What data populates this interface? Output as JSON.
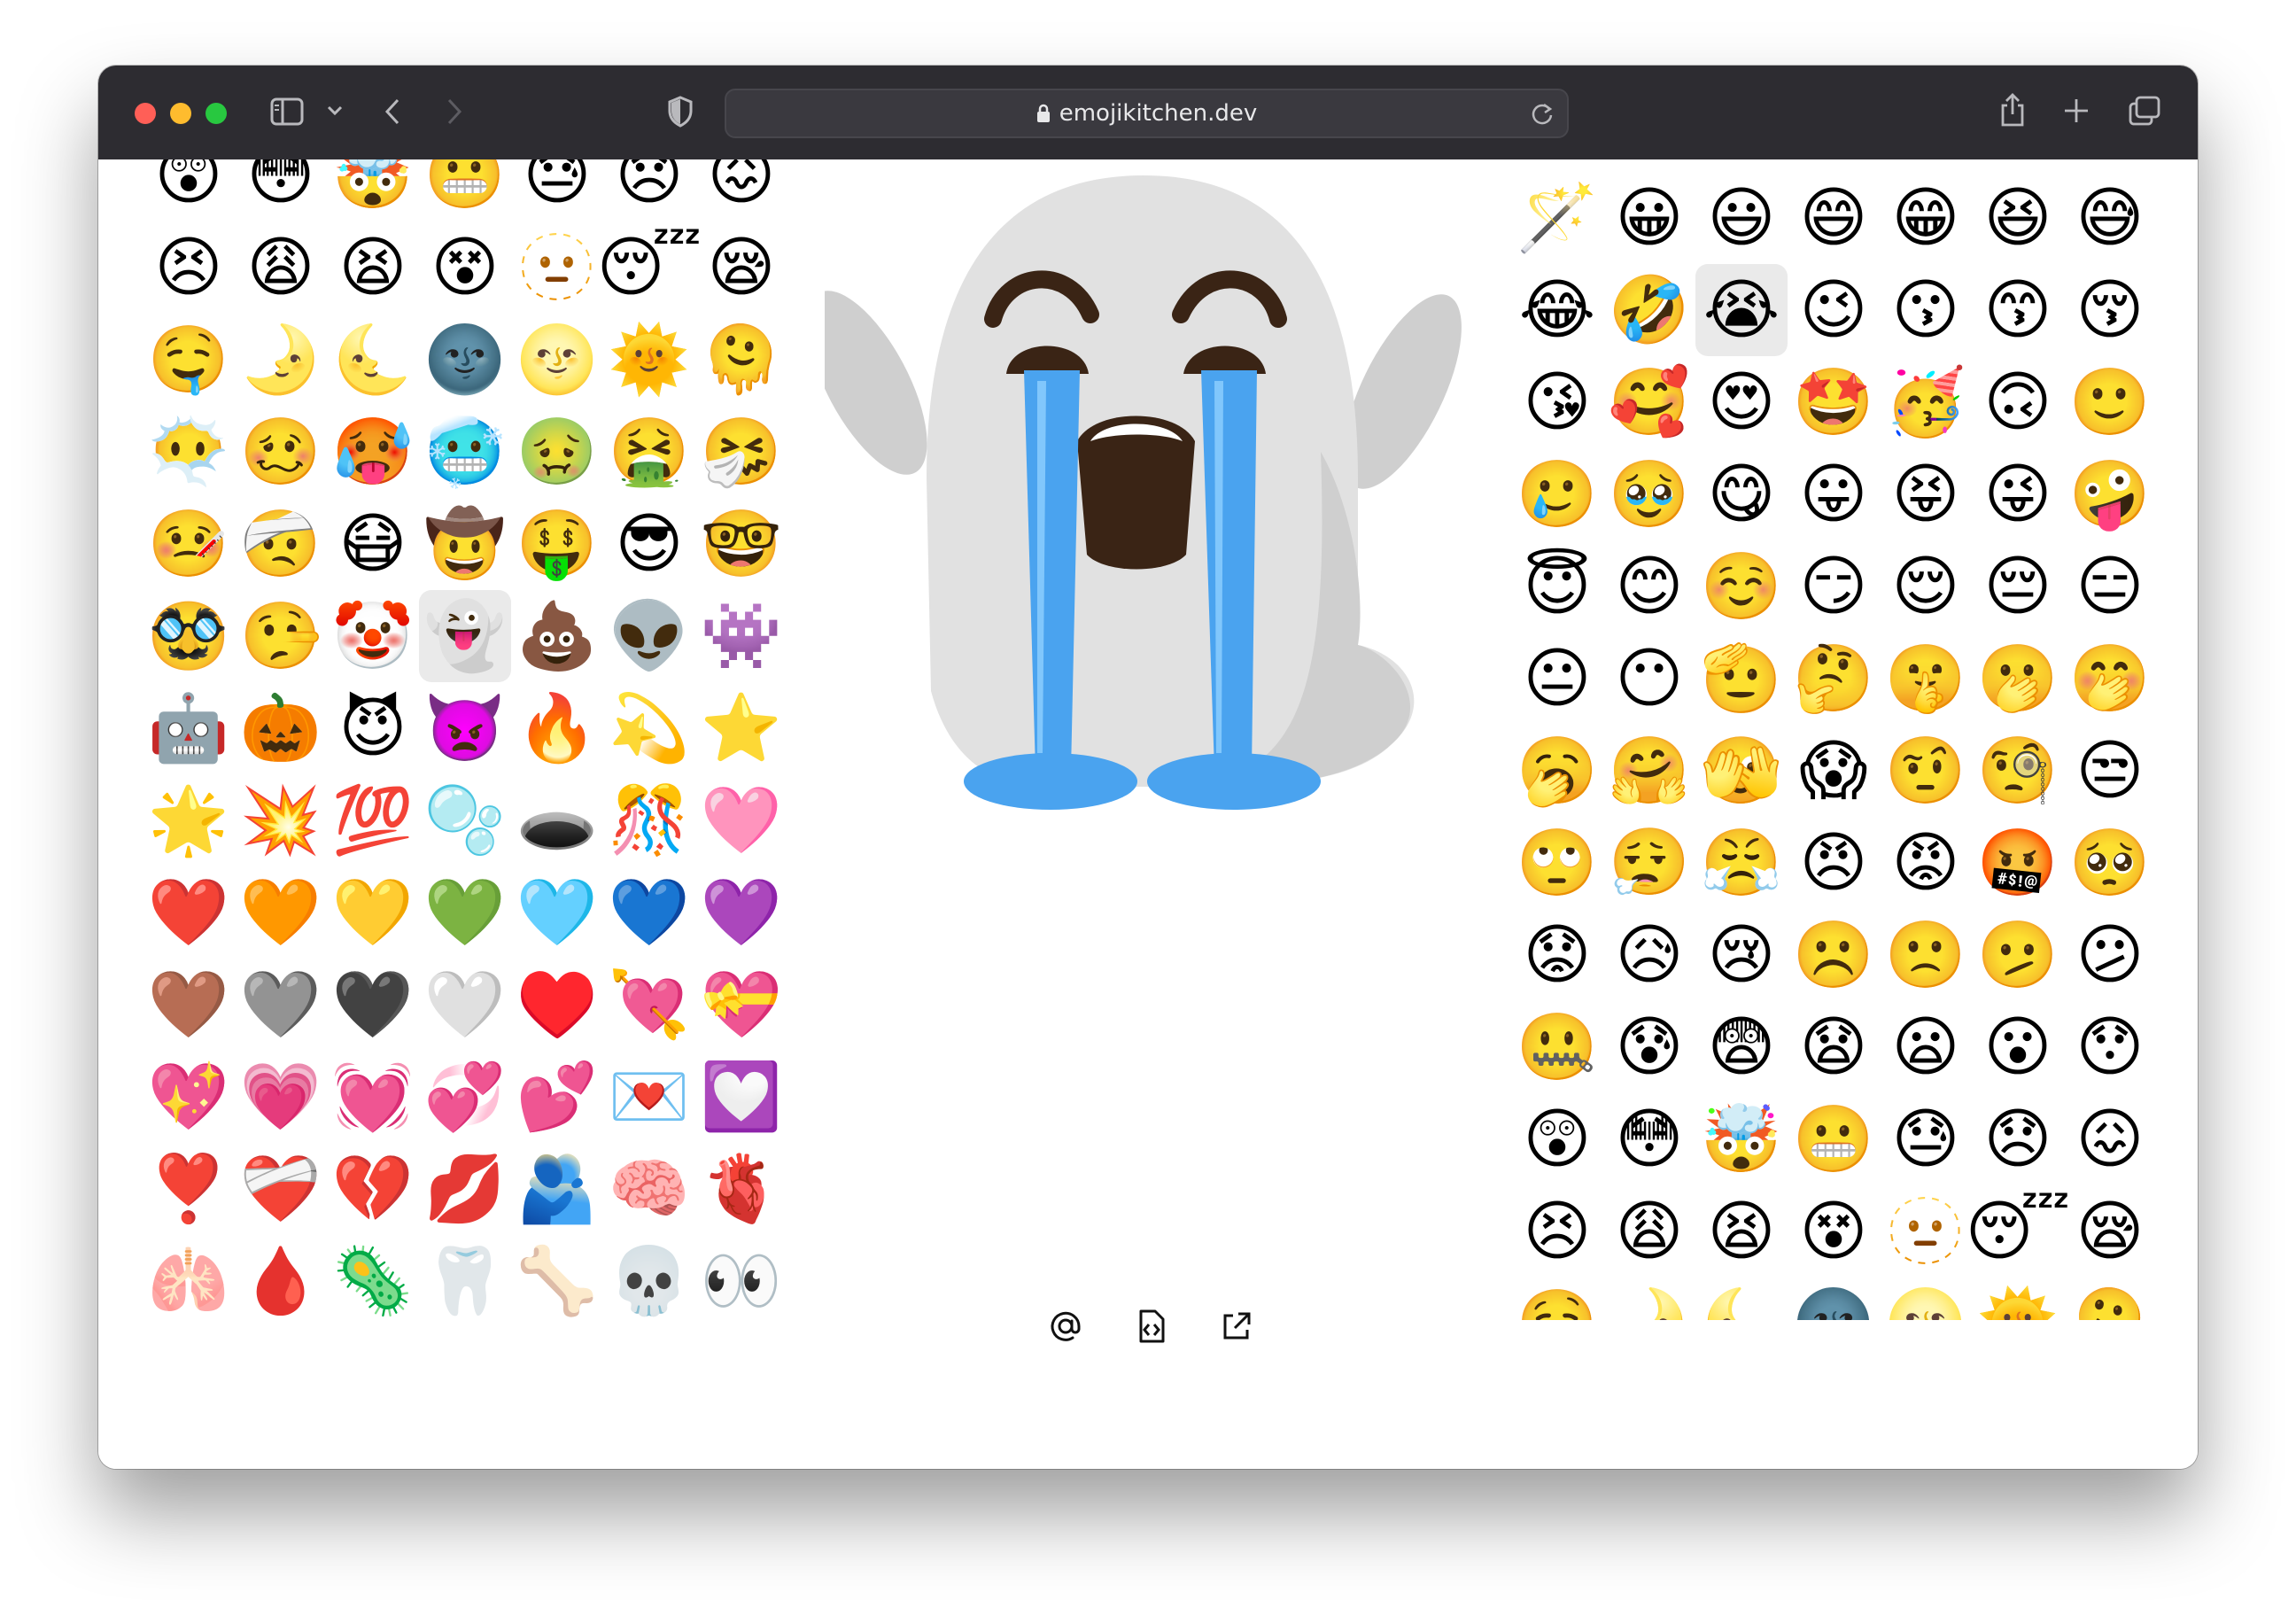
{
  "browser": {
    "url": "emojikitchen.dev",
    "icons": [
      "sidebar-icon",
      "chevron-down-icon",
      "back-icon",
      "forward-icon",
      "shield-icon",
      "lock-icon",
      "reload-icon",
      "share-icon",
      "new-tab-icon",
      "tab-overview-icon"
    ]
  },
  "left_grid": {
    "selected_index": 38,
    "emojis": [
      "😲",
      "😳",
      "🤯",
      "😬",
      "😓",
      "😞",
      "😖",
      "😣",
      "😩",
      "😫",
      "😵",
      "🫥",
      "😴",
      "😪",
      "🤤",
      "🌛",
      "🌜",
      "🌚",
      "🌝",
      "🌞",
      "🫠",
      "😶‍🌫️",
      "🥴",
      "🥵",
      "🥶",
      "🤢",
      "🤮",
      "🤧",
      "🤒",
      "🤕",
      "😷",
      "🤠",
      "🤑",
      "😎",
      "🤓",
      "🥸",
      "🤥",
      "🤡",
      "👻",
      "💩",
      "👽",
      "👾",
      "🤖",
      "🎃",
      "😈",
      "👿",
      "🔥",
      "💫",
      "⭐",
      "🌟",
      "💥",
      "💯",
      "🫧",
      "🕳️",
      "🎊",
      "🩷",
      "❤️",
      "🧡",
      "💛",
      "💚",
      "🩵",
      "💙",
      "💜",
      "🤎",
      "🩶",
      "🖤",
      "🤍",
      "♥️",
      "💘",
      "💝",
      "💖",
      "💗",
      "💓",
      "💞",
      "💕",
      "💌",
      "💟",
      "❣️",
      "❤️‍🩹",
      "💔",
      "💋",
      "🫂",
      "🧠",
      "🫀",
      "🫁",
      "🩸",
      "🦠",
      "🦷",
      "🦴",
      "💀",
      "👀"
    ]
  },
  "right_grid": {
    "selected_index": 9,
    "emojis": [
      "🪄",
      "😀",
      "😃",
      "😄",
      "😁",
      "😆",
      "😅",
      "😂",
      "🤣",
      "😭",
      "😉",
      "😗",
      "😙",
      "😚",
      "😘",
      "🥰",
      "😍",
      "🤩",
      "🥳",
      "🙃",
      "🙂",
      "🥲",
      "🥹",
      "😋",
      "😛",
      "😝",
      "😜",
      "🤪",
      "😇",
      "😊",
      "☺️",
      "😏",
      "😌",
      "😔",
      "😑",
      "😐",
      "😶",
      "🫡",
      "🤔",
      "🤫",
      "🫢",
      "🤭",
      "🥱",
      "🤗",
      "🫣",
      "😱",
      "🤨",
      "🧐",
      "😒",
      "🙄",
      "😮‍💨",
      "😤",
      "😠",
      "😡",
      "🤬",
      "🥺",
      "😟",
      "😥",
      "😢",
      "☹️",
      "🙁",
      "🫤",
      "😕",
      "🤐",
      "😰",
      "😨",
      "😧",
      "😦",
      "😮",
      "😯",
      "😲",
      "😳",
      "🤯",
      "😬",
      "😓",
      "😞",
      "😖",
      "😣",
      "😩",
      "😫",
      "😵",
      "🫥",
      "😴",
      "😪",
      "🤤",
      "🌛",
      "🌜",
      "🌚",
      "🌝",
      "🌞",
      "🫠"
    ]
  },
  "preview": {
    "combination": [
      "👻",
      "😭"
    ],
    "ghost_color": "#e1e1e1",
    "ghost_shadow": "#cfcfcf",
    "tear_color": "#4aa3ef",
    "feature_color": "#3a2415"
  },
  "actions": [
    {
      "icon": "at-sign-icon"
    },
    {
      "icon": "code-file-icon"
    },
    {
      "icon": "open-external-icon"
    }
  ]
}
